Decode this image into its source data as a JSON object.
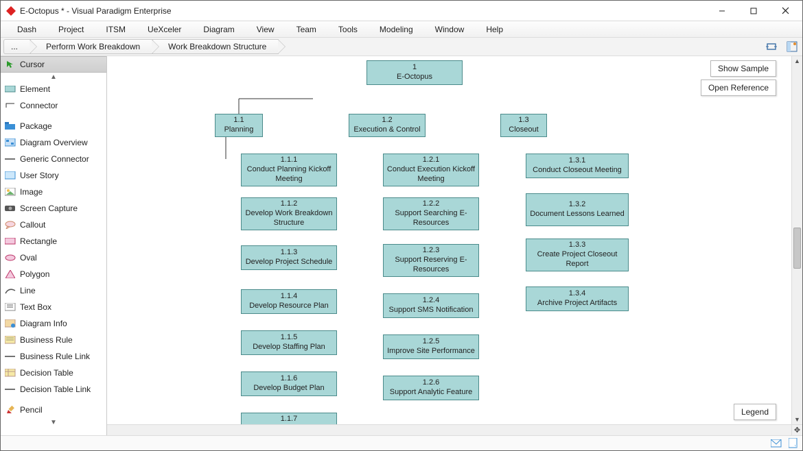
{
  "window": {
    "title": "E-Octopus * - Visual Paradigm Enterprise"
  },
  "menu": {
    "items": [
      "Dash",
      "Project",
      "ITSM",
      "UeXceler",
      "Diagram",
      "View",
      "Team",
      "Tools",
      "Modeling",
      "Window",
      "Help"
    ]
  },
  "breadcrumb": {
    "first": "...",
    "second": "Perform Work Breakdown",
    "third": "Work Breakdown Structure"
  },
  "palette": {
    "cursor": "Cursor",
    "element": "Element",
    "connector": "Connector",
    "package": "Package",
    "diagram_overview": "Diagram Overview",
    "generic_connector": "Generic Connector",
    "user_story": "User Story",
    "image": "Image",
    "screen_capture": "Screen Capture",
    "callout": "Callout",
    "rectangle": "Rectangle",
    "oval": "Oval",
    "polygon": "Polygon",
    "line": "Line",
    "text_box": "Text Box",
    "diagram_info": "Diagram Info",
    "business_rule": "Business Rule",
    "business_rule_link": "Business Rule Link",
    "decision_table": "Decision Table",
    "decision_table_link": "Decision Table Link",
    "pencil": "Pencil"
  },
  "actions": {
    "show_sample": "Show Sample",
    "open_reference": "Open Reference",
    "legend": "Legend"
  },
  "wbs": {
    "root": {
      "num": "1",
      "label": "E-Octopus"
    },
    "planning": {
      "num": "1.1",
      "label": "Planning"
    },
    "execution": {
      "num": "1.2",
      "label": "Execution & Control"
    },
    "closeout": {
      "num": "1.3",
      "label": "Closeout"
    },
    "p1": {
      "num": "1.1.1",
      "label": "Conduct Planning Kickoff Meeting"
    },
    "p2": {
      "num": "1.1.2",
      "label": "Develop Work Breakdown Structure"
    },
    "p3": {
      "num": "1.1.3",
      "label": "Develop Project Schedule"
    },
    "p4": {
      "num": "1.1.4",
      "label": "Develop Resource Plan"
    },
    "p5": {
      "num": "1.1.5",
      "label": "Develop Staffing Plan"
    },
    "p6": {
      "num": "1.1.6",
      "label": "Develop Budget Plan"
    },
    "p7": {
      "num": "1.1.7",
      "label": ""
    },
    "e1": {
      "num": "1.2.1",
      "label": "Conduct Execution Kickoff Meeting"
    },
    "e2": {
      "num": "1.2.2",
      "label": "Support Searching E-Resources"
    },
    "e3": {
      "num": "1.2.3",
      "label": "Support Reserving E-Resources"
    },
    "e4": {
      "num": "1.2.4",
      "label": "Support SMS Notification"
    },
    "e5": {
      "num": "1.2.5",
      "label": "Improve Site Performance"
    },
    "e6": {
      "num": "1.2.6",
      "label": "Support Analytic Feature"
    },
    "c1": {
      "num": "1.3.1",
      "label": "Conduct Closeout Meeting"
    },
    "c2": {
      "num": "1.3.2",
      "label": "Document Lessons Learned"
    },
    "c3": {
      "num": "1.3.3",
      "label": "Create Project Closeout Report"
    },
    "c4": {
      "num": "1.3.4",
      "label": "Archive Project Artifacts"
    }
  }
}
